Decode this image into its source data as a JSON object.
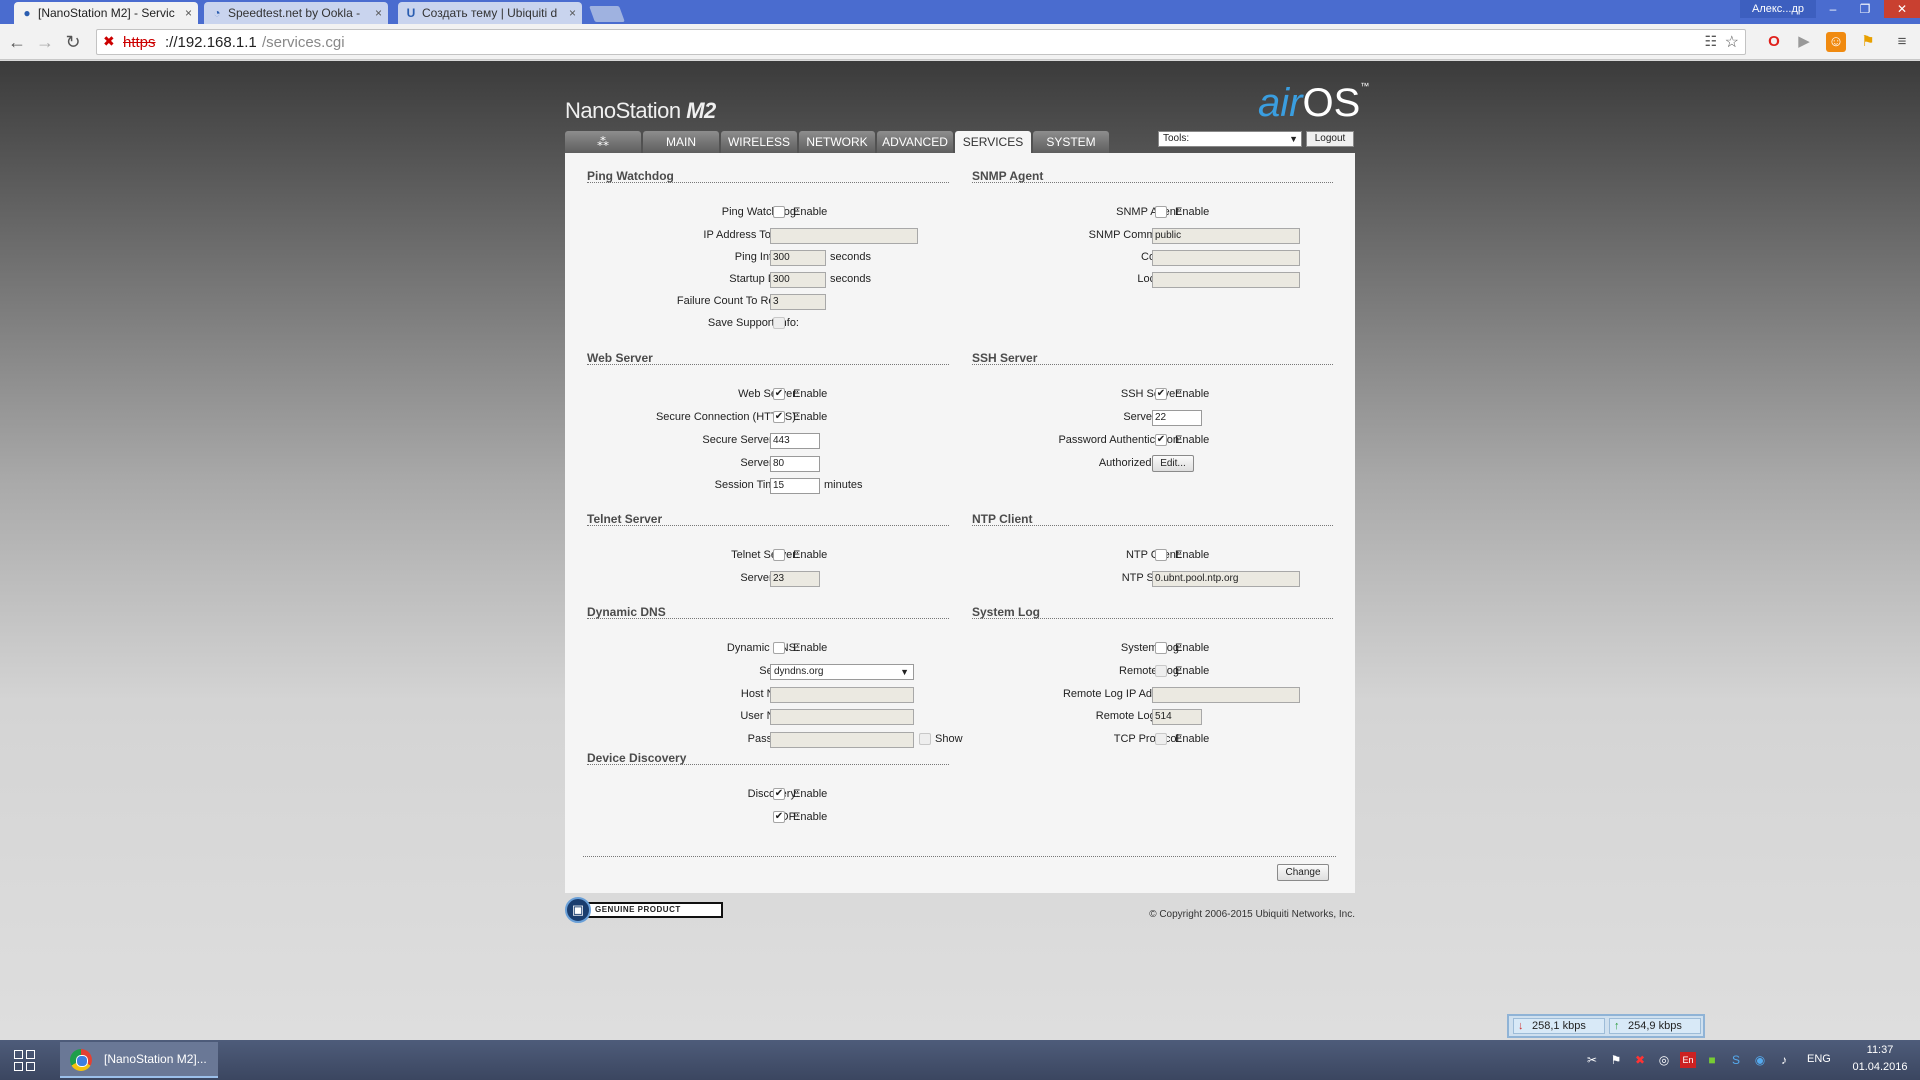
{
  "browser": {
    "tabs": [
      {
        "title": "[NanoStation M2] - Servic",
        "icon": "wifi-icon",
        "active": true
      },
      {
        "title": "Speedtest.net by Ookla -",
        "icon": "speedometer-icon",
        "active": false
      },
      {
        "title": "Создать тему | Ubiquiti d",
        "icon": "ubiquiti-u-icon",
        "active": false
      }
    ],
    "close_glyph": "×",
    "user_label": "Алекс...др",
    "window_controls": {
      "minimize": "–",
      "restore": "❐",
      "close": "✕"
    },
    "url": {
      "scheme": "https",
      "host": "://192.168.1.1",
      "path": "/services.cgi"
    }
  },
  "device": {
    "brand": "NanoStation",
    "model": "M2",
    "logo_air": "air",
    "logo_os": "OS",
    "logo_tm": "™"
  },
  "nav": {
    "tabs": [
      "MAIN",
      "WIRELESS",
      "NETWORK",
      "ADVANCED",
      "SERVICES",
      "SYSTEM"
    ],
    "active": "SERVICES",
    "tools_label": "Tools:",
    "logout_label": "Logout"
  },
  "sections": {
    "ping_watchdog": {
      "title": "Ping Watchdog",
      "ping_watchdog_label": "Ping Watchdog:",
      "enable": "Enable",
      "ip_label": "IP Address To Ping:",
      "ip_value": "",
      "interval_label": "Ping Interval:",
      "interval_value": "300",
      "interval_unit": "seconds",
      "startup_label": "Startup Delay:",
      "startup_value": "300",
      "startup_unit": "seconds",
      "failure_label": "Failure Count To Reboot:",
      "failure_value": "3",
      "support_label": "Save Support Info:"
    },
    "snmp": {
      "title": "SNMP Agent",
      "agent_label": "SNMP Agent:",
      "enable": "Enable",
      "community_label": "SNMP Community:",
      "community_value": "public",
      "contact_label": "Contact:",
      "contact_value": "",
      "location_label": "Location:",
      "location_value": ""
    },
    "web_server": {
      "title": "Web Server",
      "server_label": "Web Server:",
      "enable": "Enable",
      "https_label": "Secure Connection (HTTPS):",
      "https_enable": "Enable",
      "secure_port_label": "Secure Server Port:",
      "secure_port_value": "443",
      "port_label": "Server Port:",
      "port_value": "80",
      "timeout_label": "Session Timeout:",
      "timeout_value": "15",
      "timeout_unit": "minutes"
    },
    "ssh": {
      "title": "SSH Server",
      "server_label": "SSH Server:",
      "enable": "Enable",
      "port_label": "Server Port:",
      "port_value": "22",
      "password_label": "Password Authentication:",
      "password_enable": "Enable",
      "keys_label": "Authorized Keys:",
      "keys_button": "Edit..."
    },
    "telnet": {
      "title": "Telnet Server",
      "server_label": "Telnet Server:",
      "enable": "Enable",
      "port_label": "Server Port:",
      "port_value": "23"
    },
    "ntp": {
      "title": "NTP Client",
      "client_label": "NTP Client:",
      "enable": "Enable",
      "server_label": "NTP Server:",
      "server_value": "0.ubnt.pool.ntp.org"
    },
    "ddns": {
      "title": "Dynamic DNS",
      "ddns_label": "Dynamic DNS:",
      "enable": "Enable",
      "service_label": "Service:",
      "service_value": "dyndns.org",
      "host_label": "Host Name:",
      "host_value": "",
      "user_label": "User Name:",
      "user_value": "",
      "password_label": "Password:",
      "password_value": "",
      "show_label": "Show"
    },
    "syslog": {
      "title": "System Log",
      "log_label": "System Log:",
      "enable": "Enable",
      "remote_label": "Remote Log:",
      "remote_enable": "Enable",
      "remote_ip_label": "Remote Log IP Address:",
      "remote_ip_value": "",
      "remote_port_label": "Remote Log Port:",
      "remote_port_value": "514",
      "tcp_label": "TCP Protocol:",
      "tcp_enable": "Enable"
    },
    "discovery": {
      "title": "Device Discovery",
      "discovery_label": "Discovery:",
      "enable": "Enable",
      "cdp_label": "CDP:",
      "cdp_enable": "Enable"
    }
  },
  "footer": {
    "change_button": "Change",
    "genuine_text": "GENUINE  PRODUCT",
    "copyright": "© Copyright 2006-2015 Ubiquiti Networks, Inc."
  },
  "bandwidth": {
    "down": "258,1 kbps",
    "up": "254,9 kbps",
    "down_arrow": "↓",
    "up_arrow": "↑",
    "down_color": "#d03030",
    "up_color": "#2a9a3a"
  },
  "taskbar": {
    "window_title": "[NanoStation M2]...",
    "language": "ENG",
    "time": "11:37",
    "date": "01.04.2016"
  }
}
